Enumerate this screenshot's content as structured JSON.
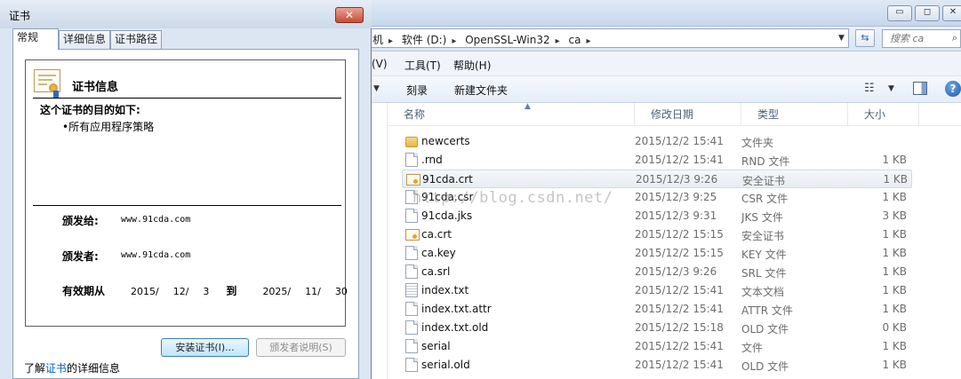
{
  "explorer": {
    "window_controls": {
      "minimize": "▭",
      "maximize": "◻",
      "close": "✕"
    },
    "breadcrumb": [
      "机",
      "软件 (D:)",
      "OpenSSL-Win32",
      "ca"
    ],
    "search_placeholder": "搜索 ca",
    "menu": [
      "(V)",
      "工具(T)",
      "帮助(H)"
    ],
    "toolbar": {
      "burn": "刻录",
      "new_folder": "新建文件夹"
    },
    "columns": {
      "name": "名称",
      "modified": "修改日期",
      "type": "类型",
      "size": "大小"
    },
    "files": [
      {
        "name": "newcerts",
        "modified": "2015/12/2 15:41",
        "type": "文件夹",
        "size": "",
        "icon": "folder-icon"
      },
      {
        "name": ".rnd",
        "modified": "2015/12/2 15:41",
        "type": "RND 文件",
        "size": "1 KB",
        "icon": "file-icon"
      },
      {
        "name": "91cda.crt",
        "modified": "2015/12/3 9:26",
        "type": "安全证书",
        "size": "1 KB",
        "icon": "certificate-icon",
        "selected": true
      },
      {
        "name": "91cda.csr",
        "modified": "2015/12/3 9:25",
        "type": "CSR 文件",
        "size": "1 KB",
        "icon": "file-icon"
      },
      {
        "name": "91cda.jks",
        "modified": "2015/12/3 9:31",
        "type": "JKS 文件",
        "size": "3 KB",
        "icon": "file-icon"
      },
      {
        "name": "ca.crt",
        "modified": "2015/12/2 15:15",
        "type": "安全证书",
        "size": "1 KB",
        "icon": "certificate-icon"
      },
      {
        "name": "ca.key",
        "modified": "2015/12/2 15:15",
        "type": "KEY 文件",
        "size": "1 KB",
        "icon": "file-icon"
      },
      {
        "name": "ca.srl",
        "modified": "2015/12/3 9:26",
        "type": "SRL 文件",
        "size": "1 KB",
        "icon": "file-icon"
      },
      {
        "name": "index.txt",
        "modified": "2015/12/2 15:41",
        "type": "文本文档",
        "size": "1 KB",
        "icon": "text-file-icon"
      },
      {
        "name": "index.txt.attr",
        "modified": "2015/12/2 15:41",
        "type": "ATTR 文件",
        "size": "1 KB",
        "icon": "file-icon"
      },
      {
        "name": "index.txt.old",
        "modified": "2015/12/2 15:18",
        "type": "OLD 文件",
        "size": "0 KB",
        "icon": "file-icon"
      },
      {
        "name": "serial",
        "modified": "2015/12/2 15:41",
        "type": "文件",
        "size": "1 KB",
        "icon": "file-icon"
      },
      {
        "name": "serial.old",
        "modified": "2015/12/2 15:41",
        "type": "OLD 文件",
        "size": "1 KB",
        "icon": "file-icon"
      }
    ],
    "watermark": "http://blog.csdn.net/"
  },
  "cert_dialog": {
    "title": "证书",
    "close": "✕",
    "tabs": [
      "常规",
      "详细信息",
      "证书路径"
    ],
    "info_title": "证书信息",
    "purpose_heading": "这个证书的目的如下:",
    "purpose_item": "•所有应用程序策略",
    "issued_to_label": "颁发给:",
    "issued_to": "www.91cda.com",
    "issued_by_label": "颁发者:",
    "issued_by": "www.91cda.com",
    "validity_label": "有效期从",
    "valid_from": [
      "2015/",
      "12/",
      "3"
    ],
    "to_word": "到",
    "valid_to": [
      "2025/",
      "11/",
      "30"
    ],
    "install_button": "安装证书(I)...",
    "issuer_statement_button": "颁发者说明(S)",
    "learn_prefix": "了解",
    "learn_link": "证书",
    "learn_suffix": "的详细信息"
  }
}
